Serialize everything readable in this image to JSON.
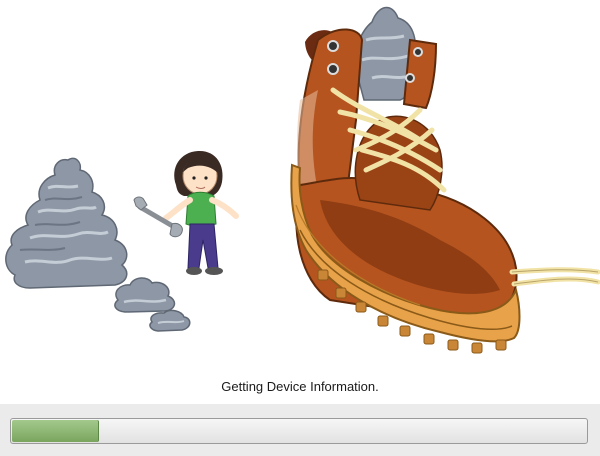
{
  "window": {
    "illustration_name": "boot-and-girl-illustration"
  },
  "status": {
    "text": "Getting Device Information."
  },
  "progress": {
    "fraction": 0.15,
    "fill_color": "#8cb874",
    "track_color": "#ececec"
  },
  "colors": {
    "background": "#ffffff",
    "boot_leather": "#b5541f",
    "boot_sole": "#e8a24a",
    "laces": "#f1e2a6",
    "rocks": "#8d97a5",
    "shirt": "#4caf50",
    "pants": "#4a3b8c"
  }
}
